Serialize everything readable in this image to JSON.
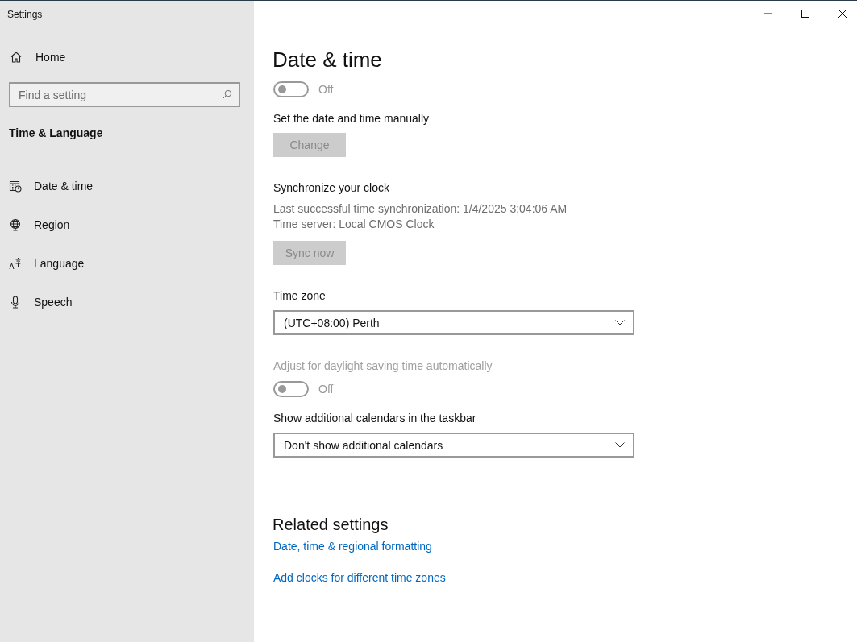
{
  "window": {
    "title": "Settings"
  },
  "sidebar": {
    "home": "Home",
    "search": {
      "placeholder": "Find a setting"
    },
    "section_title": "Time & Language",
    "items": [
      {
        "label": "Date & time",
        "kind": "calendar"
      },
      {
        "label": "Region",
        "kind": "globe"
      },
      {
        "label": "Language",
        "kind": "language"
      },
      {
        "label": "Speech",
        "kind": "microphone"
      }
    ]
  },
  "page": {
    "title": "Date & time",
    "items": [
      {
        "kind": "toggle",
        "on": false,
        "state_label": "Off",
        "disabled": true
      },
      {
        "kind": "label",
        "text": "Set the date and time manually",
        "disabled": false
      },
      {
        "kind": "button",
        "text": "Change",
        "disabled": true
      },
      {
        "kind": "label",
        "text": "Synchronize your clock",
        "disabled": false
      },
      {
        "kind": "info",
        "text": "Last successful time synchronization: 1/4/2025 3:04:06 AM"
      },
      {
        "kind": "info",
        "text": "Time server: Local CMOS Clock"
      },
      {
        "kind": "button",
        "text": "Sync now",
        "disabled": true
      },
      {
        "kind": "label",
        "text": "Time zone",
        "disabled": false
      },
      {
        "kind": "dropdown",
        "value": "(UTC+08:00) Perth"
      },
      {
        "kind": "label",
        "text": "Adjust for daylight saving time automatically",
        "disabled": true
      },
      {
        "kind": "toggle",
        "on": false,
        "state_label": "Off",
        "disabled": true
      },
      {
        "kind": "label",
        "text": "Show additional calendars in the taskbar",
        "disabled": false
      },
      {
        "kind": "dropdown",
        "value": "Don't show additional calendars"
      }
    ]
  },
  "related": {
    "title": "Related settings",
    "links": [
      "Date, time & regional formatting",
      "Add clocks for different time zones"
    ]
  }
}
